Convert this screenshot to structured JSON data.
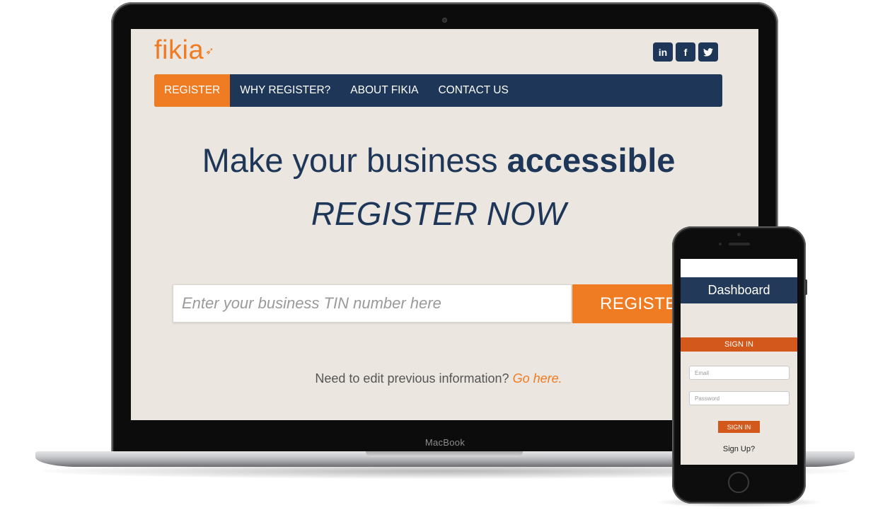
{
  "device_label": "MacBook",
  "site": {
    "logo_text": "fikia",
    "social": [
      {
        "icon": "linkedin-icon",
        "glyph": "in"
      },
      {
        "icon": "facebook-icon",
        "glyph": "f"
      },
      {
        "icon": "twitter-icon",
        "glyph": "🐦"
      }
    ],
    "nav": [
      "REGISTER",
      "WHY REGISTER?",
      "ABOUT FIKIA",
      "CONTACT US"
    ],
    "headline_light": "Make your business ",
    "headline_bold": "accessible",
    "subhead": "REGISTER NOW",
    "tin_placeholder": "Enter your business TIN number here",
    "register_button": "REGISTER",
    "edit_text": "Need to edit previous information? ",
    "edit_link": "Go here."
  },
  "phone": {
    "header": "Dashboard",
    "signin_bar": "SIGN IN",
    "email_placeholder": "Email",
    "password_placeholder": "Password",
    "signin_button": "SIGN IN",
    "signup_link": "Sign Up?"
  },
  "colors": {
    "navy": "#1e3658",
    "orange": "#ef7b22",
    "page_bg": "#ebe7e0",
    "phone_orange": "#d2581b"
  }
}
